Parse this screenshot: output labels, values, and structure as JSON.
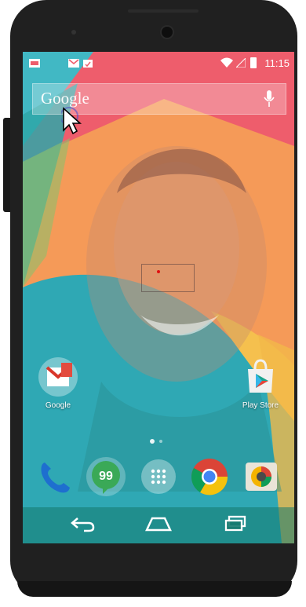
{
  "status_bar": {
    "time": "11:15",
    "icons": [
      "image-notification-icon",
      "gmail-notification-icon",
      "clipboard-notification-icon",
      "wifi-icon",
      "signal-icon",
      "battery-icon"
    ]
  },
  "search": {
    "logo_text": "Google",
    "mic_icon": "mic-icon"
  },
  "home_apps": [
    {
      "label": "Google",
      "icon": "google-folder-icon"
    },
    {
      "label": "Play Store",
      "icon": "play-store-icon"
    }
  ],
  "dock": [
    {
      "icon": "phone-icon"
    },
    {
      "icon": "hangouts-icon"
    },
    {
      "icon": "app-drawer-icon"
    },
    {
      "icon": "chrome-icon"
    },
    {
      "icon": "camera-icon"
    }
  ],
  "nav": [
    "back-icon",
    "home-icon",
    "recents-icon"
  ],
  "colors": {
    "wallpaper_red": "#ef5a6a",
    "wallpaper_orange": "#f7a155",
    "wallpaper_teal": "#3db4b8",
    "wallpaper_yellow": "#f6c35a",
    "face_marker": "#e01010"
  }
}
